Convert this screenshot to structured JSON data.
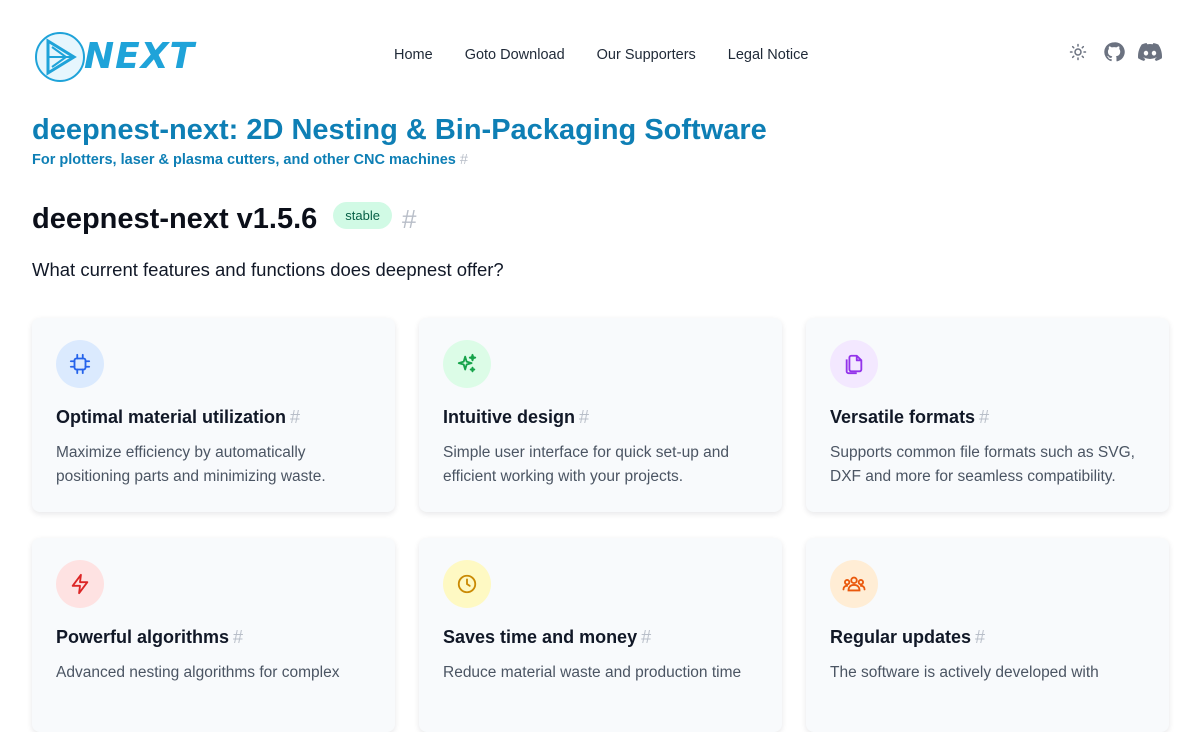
{
  "header": {
    "logo_text": "NEXT",
    "nav": [
      {
        "label": "Home"
      },
      {
        "label": "Goto Download"
      },
      {
        "label": "Our Supporters"
      },
      {
        "label": "Legal Notice"
      }
    ],
    "icons": [
      "sun-icon",
      "github-icon",
      "discord-icon"
    ]
  },
  "hero": {
    "title": "deepnest-next: 2D Nesting & Bin-Packaging Software",
    "subtitle": "For plotters, laser & plasma cutters, and other CNC machines",
    "anchor": "#"
  },
  "version": {
    "title": "deepnest-next v1.5.6",
    "badge": "stable",
    "anchor": "#"
  },
  "lead": "What current features and functions does deepnest offer?",
  "features": [
    {
      "title": "Optimal material utilization",
      "desc": "Maximize efficiency by automatically positioning parts and minimizing waste.",
      "icon": "chip-icon",
      "bg": "#dbeafe",
      "fg": "#2563eb"
    },
    {
      "title": "Intuitive design",
      "desc": "Simple user interface for quick set-up and efficient working with your projects.",
      "icon": "sparkles-icon",
      "bg": "#dcfce7",
      "fg": "#16a34a"
    },
    {
      "title": "Versatile formats",
      "desc": "Supports common file formats such as SVG, DXF and more for seamless compatibility.",
      "icon": "copy-icon",
      "bg": "#f3e8ff",
      "fg": "#9333ea"
    },
    {
      "title": "Powerful algorithms",
      "desc": "Advanced nesting algorithms for complex",
      "icon": "bolt-icon",
      "bg": "#fee2e2",
      "fg": "#dc2626"
    },
    {
      "title": "Saves time and money",
      "desc": "Reduce material waste and production time",
      "icon": "clock-icon",
      "bg": "#fef9c3",
      "fg": "#ca8a04"
    },
    {
      "title": "Regular updates",
      "desc": "The software is actively developed with",
      "icon": "users-icon",
      "bg": "#ffedd5",
      "fg": "#ea580c"
    }
  ],
  "colors": {
    "brand": "#0e7fb5",
    "logo": "#1fa3d9",
    "badge_bg": "#d1fae5",
    "badge_fg": "#065f46"
  }
}
